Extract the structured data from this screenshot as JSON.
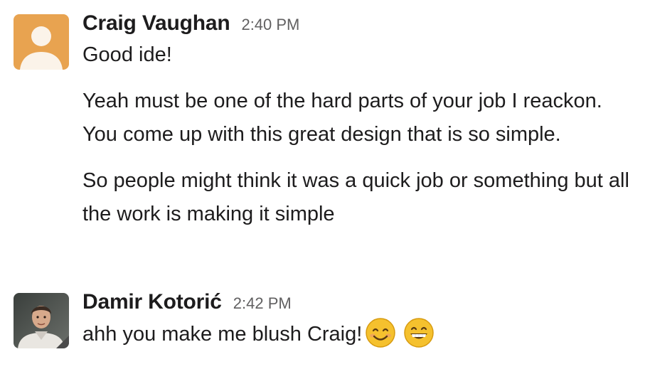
{
  "colors": {
    "avatar_bg_craig": "#e8a350",
    "text": "#1d1c1d",
    "timestamp": "#616061",
    "emoji_face": "#f5c12e"
  },
  "messages": [
    {
      "author": "Craig Vaughan",
      "time": "2:40 PM",
      "avatar_icon": "default-person-icon",
      "paragraphs": [
        "Good ide!",
        "Yeah must be one of the hard parts of your job I reackon. You come up with this great design that is so simple.",
        "So people might think it was a quick job or something but all the work is making it simple"
      ]
    },
    {
      "author": "Damir Kotorić",
      "time": "2:42 PM",
      "avatar_icon": "user-photo",
      "text": "ahh you make me blush Craig!",
      "emojis": [
        "smiling-face-icon",
        "grinning-face-icon"
      ]
    }
  ]
}
